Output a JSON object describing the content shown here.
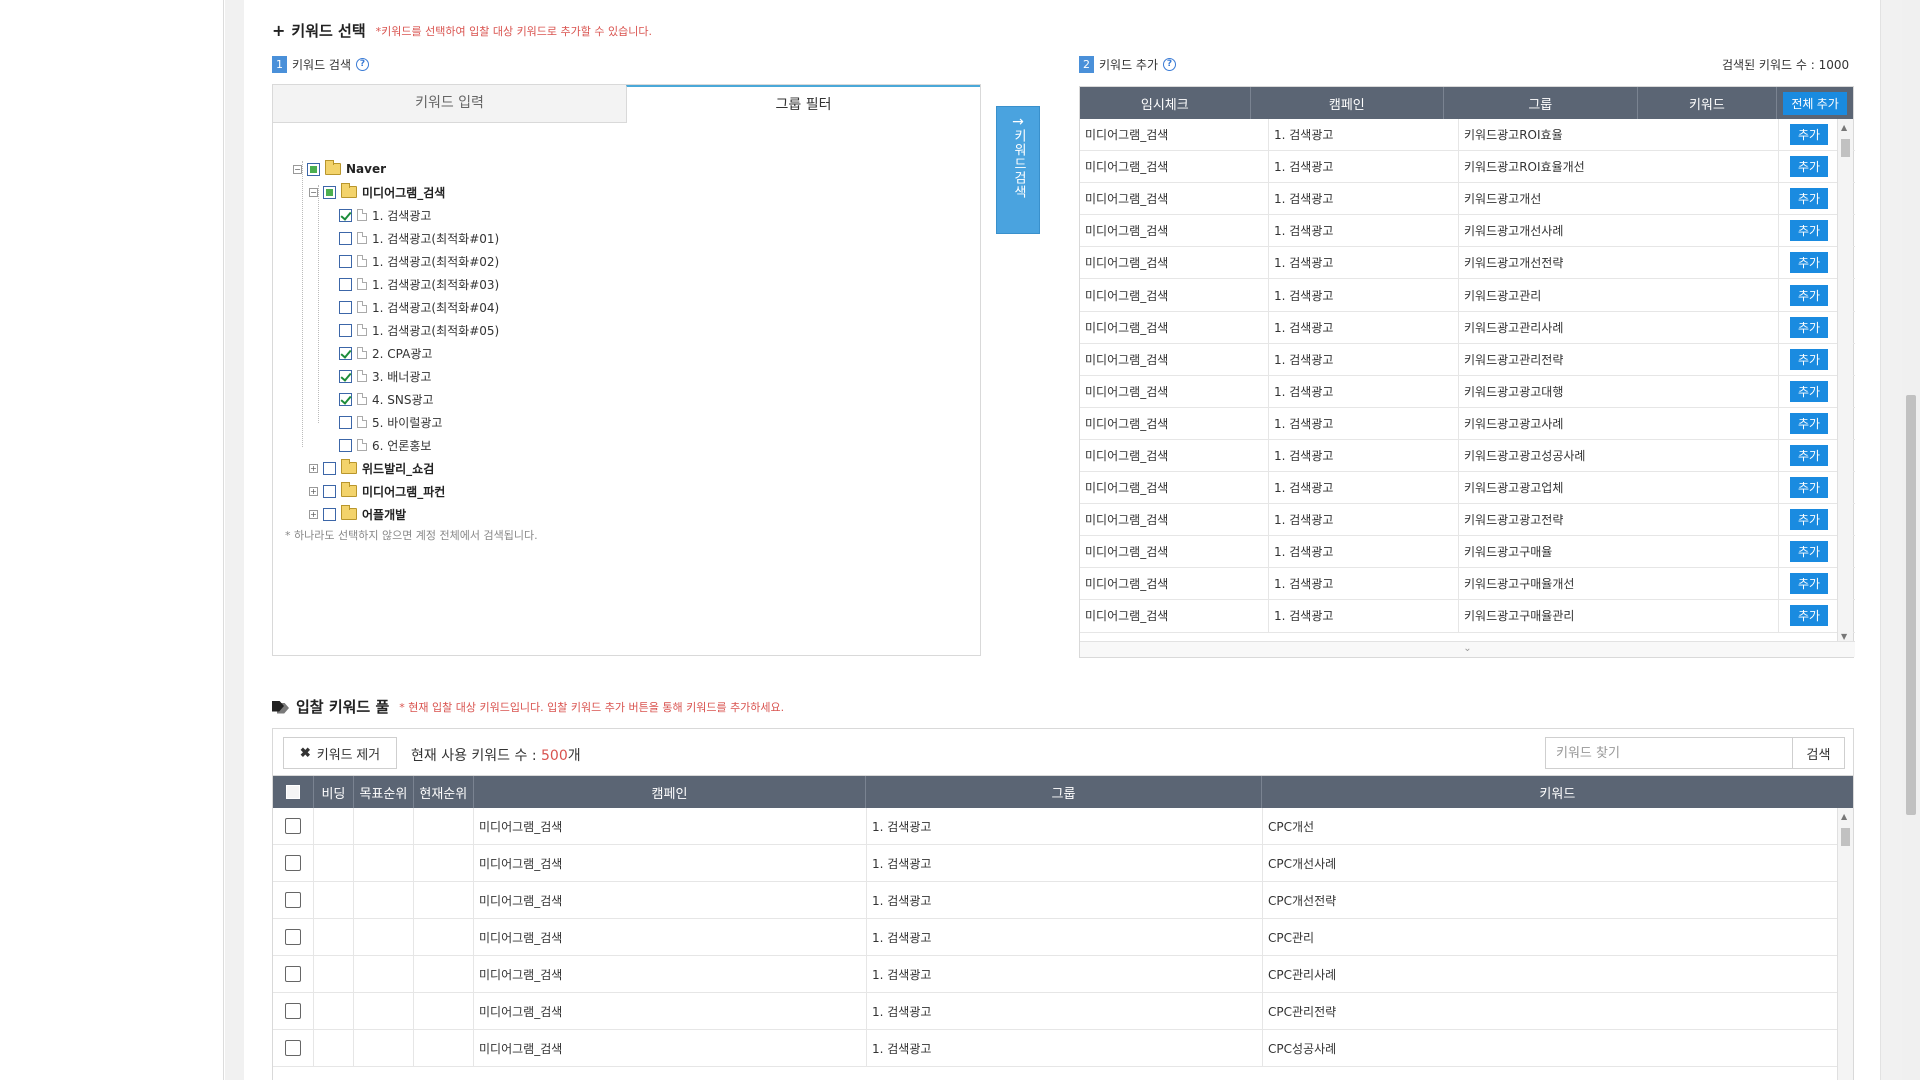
{
  "keyword_select": {
    "title": "키워드 선택",
    "note": "*키워드를 선택하여 입찰 대상 키워드로 추가할 수 있습니다.",
    "search_label": "키워드 검색",
    "search_num": "1",
    "add_label": "키워드 추가",
    "add_num": "2",
    "help_glyph": "?"
  },
  "tabs": [
    {
      "label": "키워드 입력",
      "active": false
    },
    {
      "label": "그룹 필터",
      "active": true
    }
  ],
  "tree": {
    "root": "Naver",
    "group_open": "미디어그램_검색",
    "children": [
      {
        "label": "1. 검색광고",
        "checked": true
      },
      {
        "label": "1. 검색광고(최적화#01)",
        "checked": false
      },
      {
        "label": "1. 검색광고(최적화#02)",
        "checked": false
      },
      {
        "label": "1. 검색광고(최적화#03)",
        "checked": false
      },
      {
        "label": "1. 검색광고(최적화#04)",
        "checked": false
      },
      {
        "label": "1. 검색광고(최적화#05)",
        "checked": false
      },
      {
        "label": "2. CPA광고",
        "checked": true
      },
      {
        "label": "3. 배너광고",
        "checked": true
      },
      {
        "label": "4. SNS광고",
        "checked": true
      },
      {
        "label": "5. 바이럴광고",
        "checked": false
      },
      {
        "label": "6. 언론홍보",
        "checked": false
      }
    ],
    "collapsed_groups": [
      "위드발리_쇼검",
      "미디어그램_파컨",
      "어플개발"
    ],
    "hint": "* 하나라도 선택하지 않으면 계정 전체에서 검색됩니다.",
    "expand_glyph": "+",
    "collapse_glyph": "−"
  },
  "search_button": {
    "arrow": "→",
    "label": "키워드검색"
  },
  "right": {
    "count_text": "검색된 키워드 수 : 1000",
    "headers": [
      "임시체크",
      "캠페인",
      "그룹",
      "키워드"
    ],
    "all_add_label": "전체 추가",
    "add_label": "추가",
    "rows": [
      {
        "campaign": "미디어그램_검색",
        "group": "1. 검색광고",
        "keyword": "키워드광고ROI효율"
      },
      {
        "campaign": "미디어그램_검색",
        "group": "1. 검색광고",
        "keyword": "키워드광고ROI효율개선"
      },
      {
        "campaign": "미디어그램_검색",
        "group": "1. 검색광고",
        "keyword": "키워드광고개선"
      },
      {
        "campaign": "미디어그램_검색",
        "group": "1. 검색광고",
        "keyword": "키워드광고개선사례"
      },
      {
        "campaign": "미디어그램_검색",
        "group": "1. 검색광고",
        "keyword": "키워드광고개선전략"
      },
      {
        "campaign": "미디어그램_검색",
        "group": "1. 검색광고",
        "keyword": "키워드광고관리"
      },
      {
        "campaign": "미디어그램_검색",
        "group": "1. 검색광고",
        "keyword": "키워드광고관리사례"
      },
      {
        "campaign": "미디어그램_검색",
        "group": "1. 검색광고",
        "keyword": "키워드광고관리전략"
      },
      {
        "campaign": "미디어그램_검색",
        "group": "1. 검색광고",
        "keyword": "키워드광고광고대행"
      },
      {
        "campaign": "미디어그램_검색",
        "group": "1. 검색광고",
        "keyword": "키워드광고광고사례"
      },
      {
        "campaign": "미디어그램_검색",
        "group": "1. 검색광고",
        "keyword": "키워드광고광고성공사례"
      },
      {
        "campaign": "미디어그램_검색",
        "group": "1. 검색광고",
        "keyword": "키워드광고광고업체"
      },
      {
        "campaign": "미디어그램_검색",
        "group": "1. 검색광고",
        "keyword": "키워드광고광고전략"
      },
      {
        "campaign": "미디어그램_검색",
        "group": "1. 검색광고",
        "keyword": "키워드광고구매율"
      },
      {
        "campaign": "미디어그램_검색",
        "group": "1. 검색광고",
        "keyword": "키워드광고구매율개선"
      },
      {
        "campaign": "미디어그램_검색",
        "group": "1. 검색광고",
        "keyword": "키워드광고구매율관리"
      }
    ]
  },
  "pool": {
    "title": "입찰 키워드 풀",
    "note": "* 현재 입찰 대상 키워드입니다. 입찰 키워드 추가 버튼을 통해 키워드를 추가하세요.",
    "remove_label": "키워드 제거",
    "count_prefix": "현재 사용 키워드 수 : ",
    "count_value": "500",
    "count_suffix": "개",
    "search_placeholder": "키워드 찾기",
    "search_button": "검색",
    "headers": [
      "비딩",
      "목표순위",
      "현재순위",
      "캠페인",
      "그룹",
      "키워드"
    ],
    "rows": [
      {
        "campaign": "미디어그램_검색",
        "group": "1. 검색광고",
        "keyword": "CPC개선"
      },
      {
        "campaign": "미디어그램_검색",
        "group": "1. 검색광고",
        "keyword": "CPC개선사례"
      },
      {
        "campaign": "미디어그램_검색",
        "group": "1. 검색광고",
        "keyword": "CPC개선전략"
      },
      {
        "campaign": "미디어그램_검색",
        "group": "1. 검색광고",
        "keyword": "CPC관리"
      },
      {
        "campaign": "미디어그램_검색",
        "group": "1. 검색광고",
        "keyword": "CPC관리사례"
      },
      {
        "campaign": "미디어그램_검색",
        "group": "1. 검색광고",
        "keyword": "CPC관리전략"
      },
      {
        "campaign": "미디어그램_검색",
        "group": "1. 검색광고",
        "keyword": "CPC성공사례"
      }
    ]
  },
  "colors": {
    "header_bg": "#5b6574",
    "accent_blue": "#1a8be0",
    "note_red": "#d9534f"
  }
}
